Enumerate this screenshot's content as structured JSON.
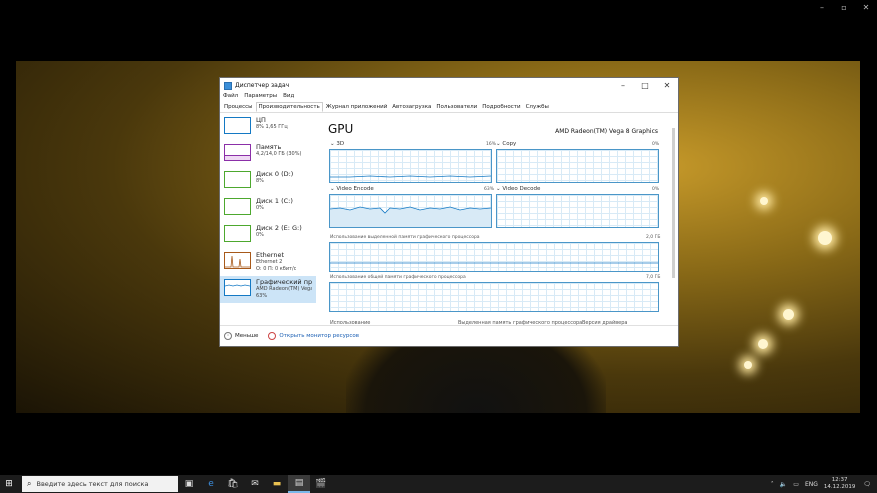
{
  "window": {
    "title": "Диспетчер задач",
    "menu": [
      "Файл",
      "Параметры",
      "Вид"
    ],
    "tabs": [
      "Процессы",
      "Производительность",
      "Журнал приложений",
      "Автозагрузка",
      "Пользователи",
      "Подробности",
      "Службы"
    ],
    "active_tab": 1
  },
  "sidebar": [
    {
      "name": "ЦП",
      "detail": "8% 1,65 ГГц",
      "extra": "",
      "color": "#1479c4"
    },
    {
      "name": "Память",
      "detail": "4,2/14,0 ГБ (30%)",
      "extra": "",
      "color": "#8b2fa8"
    },
    {
      "name": "Диск 0 (D:)",
      "detail": "8%",
      "extra": "",
      "color": "#4da82e"
    },
    {
      "name": "Диск 1 (C:)",
      "detail": "0%",
      "extra": "",
      "color": "#4da82e"
    },
    {
      "name": "Диск 2 (E: G:)",
      "detail": "0%",
      "extra": "",
      "color": "#4da82e"
    },
    {
      "name": "Ethernet",
      "detail": "Ethernet 2",
      "extra": "О: 0 П: 0 кбит/с",
      "color": "#a7591a"
    },
    {
      "name": "Графический про",
      "detail": "AMD Radeon(TM) Vega",
      "extra": "63%",
      "color": "#1479c4"
    }
  ],
  "main": {
    "title": "GPU",
    "device": "AMD Radeon(TM) Vega 8 Graphics",
    "engines": [
      {
        "name": "3D",
        "percent": "16%"
      },
      {
        "name": "Copy",
        "percent": "0%"
      },
      {
        "name": "Video Encode",
        "percent": "63%"
      },
      {
        "name": "Video Decode",
        "percent": "0%"
      }
    ],
    "dedicated_label": "Использование выделенной памяти графического процессора",
    "dedicated_value": "2,0 ГБ",
    "shared_label": "Использование общей памяти графического процессора",
    "shared_value": "7,0 ГБ",
    "bottom": [
      "Использование",
      "Выделенная память графического процессора",
      "Версия драйвера"
    ]
  },
  "footer": {
    "less": "Меньше",
    "monitor": "Открыть монитор ресурсов"
  },
  "taskbar": {
    "search_placeholder": "Введите здесь текст для поиска",
    "lang": "ENG",
    "time": "12:37",
    "date": "14.12.2019"
  }
}
